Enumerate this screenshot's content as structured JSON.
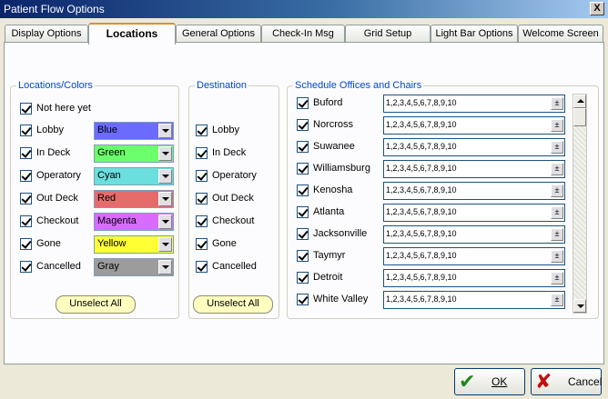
{
  "window": {
    "title": "Patient Flow Options",
    "close_glyph": "X"
  },
  "tabs": [
    {
      "label": "Display Options"
    },
    {
      "label": "Locations"
    },
    {
      "label": "General Options"
    },
    {
      "label": "Check-In Msg"
    },
    {
      "label": "Grid Setup"
    },
    {
      "label": "Light Bar Options"
    },
    {
      "label": "Welcome Screen"
    }
  ],
  "locations": {
    "legend": "Locations/Colors",
    "not_here_yet": "Not here yet",
    "items": [
      {
        "label": "Lobby",
        "color_name": "Blue",
        "color": "#6b6bff"
      },
      {
        "label": "In Deck",
        "color_name": "Green",
        "color": "#6bff6b"
      },
      {
        "label": "Operatory",
        "color_name": "Cyan",
        "color": "#6bdede"
      },
      {
        "label": "Out Deck",
        "color_name": "Red",
        "color": "#e86b6b"
      },
      {
        "label": "Checkout",
        "color_name": "Magenta",
        "color": "#d96bff"
      },
      {
        "label": "Gone",
        "color_name": "Yellow",
        "color": "#ffff33"
      },
      {
        "label": "Cancelled",
        "color_name": "Gray",
        "color": "#9c9c9c"
      }
    ],
    "unselect_label": "Unselect All"
  },
  "destination": {
    "legend": "Destination",
    "items": [
      "Lobby",
      "In Deck",
      "Operatory",
      "Out Deck",
      "Checkout",
      "Gone",
      "Cancelled"
    ],
    "unselect_label": "Unselect All"
  },
  "schedule": {
    "legend": "Schedule Offices and Chairs",
    "offices": [
      {
        "name": "Buford",
        "chairs": "1,2,3,4,5,6,7,8,9,10"
      },
      {
        "name": "Norcross",
        "chairs": "1,2,3,4,5,6,7,8,9,10"
      },
      {
        "name": "Suwanee",
        "chairs": "1,2,3,4,5,6,7,8,9,10"
      },
      {
        "name": "Williamsburg",
        "chairs": "1,2,3,4,5,6,7,8,9,10"
      },
      {
        "name": "Kenosha",
        "chairs": "1,2,3,4,5,6,7,8,9,10"
      },
      {
        "name": "Atlanta",
        "chairs": "1,2,3,4,5,6,7,8,9,10"
      },
      {
        "name": "Jacksonville",
        "chairs": "1,2,3,4,5,6,7,8,9,10"
      },
      {
        "name": "Taymyr",
        "chairs": "1,2,3,4,5,6,7,8,9,10"
      },
      {
        "name": "Detroit",
        "chairs": "1,2,3,4,5,6,7,8,9,10"
      },
      {
        "name": "White Valley",
        "chairs": "1,2,3,4,5,6,7,8,9,10"
      }
    ],
    "spin_glyph": "±"
  },
  "footer": {
    "ok_label": "OK",
    "ok_icon": "check-icon",
    "ok_color": "#1e8a1e",
    "cancel_label": "Cancel",
    "cancel_icon": "x-icon",
    "cancel_color": "#c01010"
  }
}
